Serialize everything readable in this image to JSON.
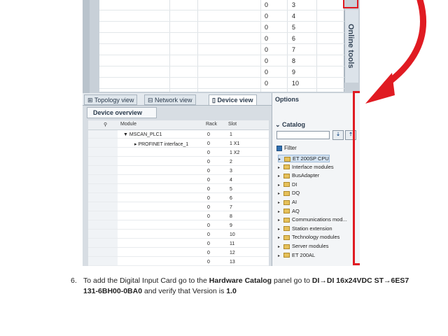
{
  "upper_rows": [
    {
      "rack": "0",
      "slot": "3"
    },
    {
      "rack": "0",
      "slot": "4"
    },
    {
      "rack": "0",
      "slot": "5"
    },
    {
      "rack": "0",
      "slot": "6"
    },
    {
      "rack": "0",
      "slot": "7"
    },
    {
      "rack": "0",
      "slot": "8"
    },
    {
      "rack": "0",
      "slot": "9"
    },
    {
      "rack": "0",
      "slot": "10"
    }
  ],
  "online_tools": "Online tools",
  "tabs": {
    "topology": "Topology view",
    "network": "Network view",
    "device": "Device view"
  },
  "device_overview": "Device overview",
  "table": {
    "headers": {
      "module": "Module",
      "rack": "Rack",
      "slot": "Slot"
    },
    "rows": [
      {
        "module": "▼ MSCAN_PLC1",
        "rack": "0",
        "slot": "1"
      },
      {
        "module": "▸ PROFINET interface_1",
        "rack": "0",
        "slot": "1 X1"
      },
      {
        "module": "",
        "rack": "0",
        "slot": "1 X2"
      },
      {
        "module": "",
        "rack": "0",
        "slot": "2"
      },
      {
        "module": "",
        "rack": "0",
        "slot": "3"
      },
      {
        "module": "",
        "rack": "0",
        "slot": "4"
      },
      {
        "module": "",
        "rack": "0",
        "slot": "5"
      },
      {
        "module": "",
        "rack": "0",
        "slot": "6"
      },
      {
        "module": "",
        "rack": "0",
        "slot": "7"
      },
      {
        "module": "",
        "rack": "0",
        "slot": "8"
      },
      {
        "module": "",
        "rack": "0",
        "slot": "9"
      },
      {
        "module": "",
        "rack": "0",
        "slot": "10"
      },
      {
        "module": "",
        "rack": "0",
        "slot": "11"
      },
      {
        "module": "",
        "rack": "0",
        "slot": "12"
      },
      {
        "module": "",
        "rack": "0",
        "slot": "13"
      }
    ]
  },
  "options": {
    "title": "Options",
    "catalog": "Catalog",
    "search_value": "",
    "filter": "Filter",
    "items": [
      "ET 200SP CPU",
      "Interface modules",
      "BusAdapter",
      "DI",
      "DQ",
      "AI",
      "AQ",
      "Communications mod...",
      "Station extension",
      "Technology modules",
      "Server modules",
      "ET 200AL"
    ]
  },
  "caption": {
    "number": "6.",
    "t1": "To add the Digital Input Card go to the ",
    "b1": "Hardware Catalog",
    "t2": " panel go to ",
    "b2": "DI→DI 16x24VDC ST→6ES7 131-6BH00-0BA0",
    "t3": " and verify that Version is ",
    "b3": "1.0"
  },
  "colors": {
    "highlight_red": "#e01b22",
    "selected_bg": "#d5e4f3"
  }
}
